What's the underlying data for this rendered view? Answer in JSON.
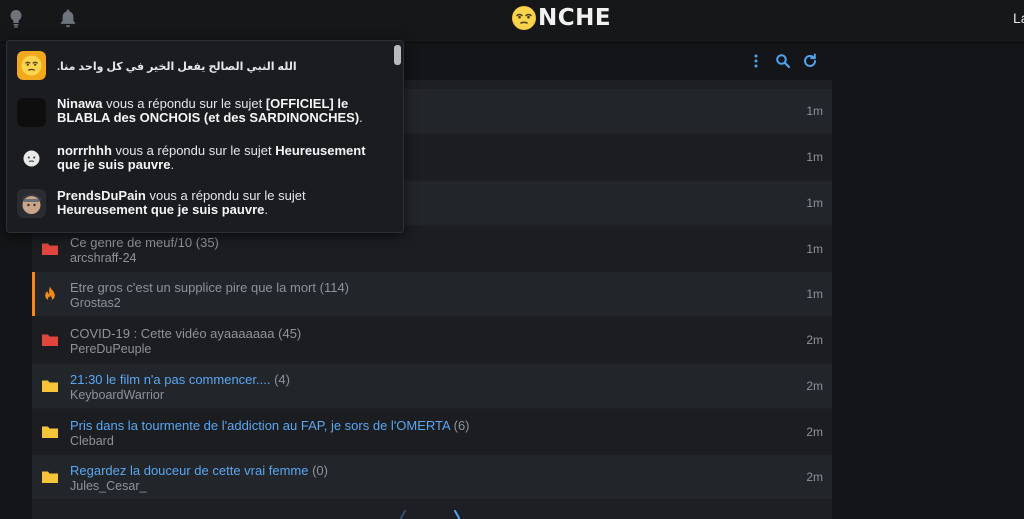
{
  "header": {
    "logo_text": "NCHE",
    "user_label": "La",
    "icons": [
      "lightbulb-icon",
      "bell-icon"
    ]
  },
  "toolbar": {
    "icons": [
      "more-vertical-icon",
      "search-icon",
      "refresh-icon"
    ]
  },
  "notifications": [
    {
      "kind": "text",
      "text": "الله النبي الصالح يفعل الخير في كل واحد منا."
    },
    {
      "kind": "reply",
      "user": "Ninawa",
      "middle": " vous a répondu sur le sujet ",
      "topic": "[OFFICIEL] le BLABLA des ONCHOIS (et des SARDINONCHES)",
      "end": "."
    },
    {
      "kind": "reply",
      "user": "norrrhhh",
      "middle": " vous a répondu sur le sujet ",
      "topic": "Heureusement que je suis pauvre",
      "end": "."
    },
    {
      "kind": "reply",
      "user": "PrendsDuPain",
      "middle": " vous a répondu sur le sujet ",
      "topic": "Heureusement que je suis pauvre",
      "end": "."
    }
  ],
  "topics": [
    {
      "title": "",
      "count": "",
      "author": "",
      "time": "1m",
      "icon": "none"
    },
    {
      "title": "",
      "count": "",
      "author": "",
      "time": "1m",
      "icon": "none"
    },
    {
      "title": "",
      "count": "",
      "author": "",
      "time": "1m",
      "icon": "none"
    },
    {
      "title": "Ce genre de meuf/10",
      "count": "(35)",
      "author": "arcshraff-24",
      "time": "1m",
      "icon": "red-folder-icon"
    },
    {
      "title": "Etre gros c'est un supplice pire que la mort",
      "count": "(114)",
      "author": "Grostas2",
      "time": "1m",
      "icon": "fire-icon"
    },
    {
      "title": "COVID-19 : Cette vidéo ayaaaaaaa",
      "count": "(45)",
      "author": "PereDuPeuple",
      "time": "2m",
      "icon": "red-folder-icon"
    },
    {
      "title": "21:30 le film n'a pas commencer....",
      "count": "(4)",
      "author": "KeyboardWarrior",
      "time": "2m",
      "icon": "yellow-folder-icon"
    },
    {
      "title": "Pris dans la tourmente de l'addiction au FAP, je sors de l'OMERTA",
      "count": "(6)",
      "author": "Clebard",
      "time": "2m",
      "icon": "yellow-folder-icon"
    },
    {
      "title": "Regardez la douceur de cette vrai femme",
      "count": "(0)",
      "author": "Jules_Cesar_",
      "time": "2m",
      "icon": "yellow-folder-icon"
    }
  ],
  "colors": {
    "background": "#141518",
    "unread_title": "#5aa7f2",
    "read_title": "#8e939b",
    "folder_red": "#e0463e",
    "folder_yellow": "#f5c43a",
    "hot_accent": "#f28a1a"
  }
}
